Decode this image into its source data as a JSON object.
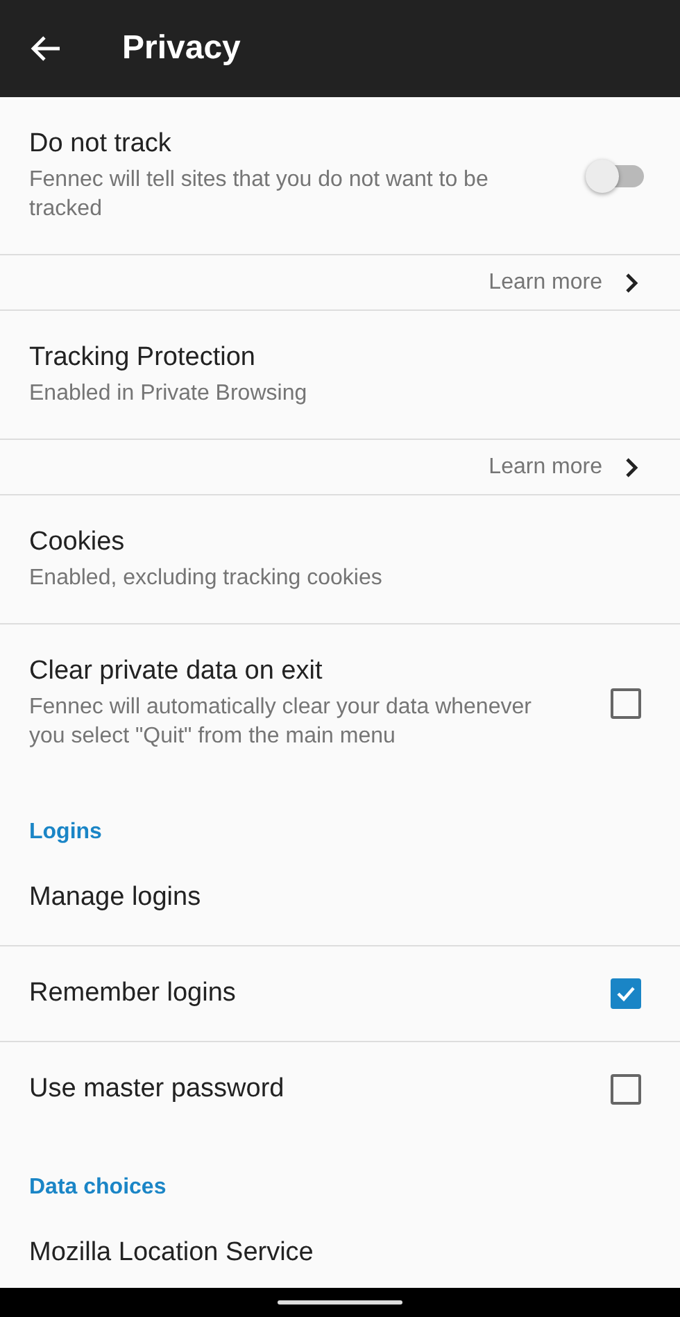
{
  "app_bar": {
    "title": "Privacy"
  },
  "sections": [
    {
      "items": [
        {
          "kind": "toggle",
          "title": "Do not track",
          "subtitle": "Fennec will tell sites that you do not want to be tracked",
          "on": false
        },
        {
          "kind": "link",
          "label": "Learn more"
        },
        {
          "kind": "plain",
          "title": "Tracking Protection",
          "subtitle": "Enabled in Private Browsing"
        },
        {
          "kind": "link",
          "label": "Learn more"
        },
        {
          "kind": "plain",
          "title": "Cookies",
          "subtitle": "Enabled, excluding tracking cookies"
        },
        {
          "kind": "checkbox",
          "title": "Clear private data on exit",
          "subtitle": "Fennec will automatically clear your data whenever you select \"Quit\" from the main menu",
          "checked": false
        }
      ]
    },
    {
      "header": "Logins",
      "items": [
        {
          "kind": "plain",
          "title": "Manage logins"
        },
        {
          "kind": "checkbox",
          "title": "Remember logins",
          "checked": true
        },
        {
          "kind": "checkbox",
          "title": "Use master password",
          "checked": false
        }
      ]
    },
    {
      "header": "Data choices",
      "items": [
        {
          "kind": "plain",
          "title": "Mozilla Location Service"
        }
      ]
    }
  ]
}
